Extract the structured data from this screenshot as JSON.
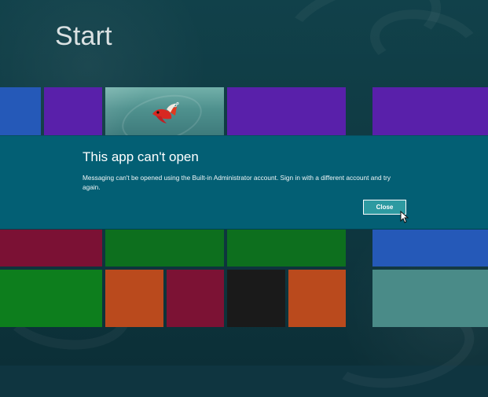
{
  "screen": {
    "title": "Start"
  },
  "dialog": {
    "title": "This app can't open",
    "message": "Messaging can't be opened using the Built-in Administrator account.  Sign in with a different account and try again.",
    "close_label": "Close"
  },
  "icons": {
    "fish": "fish-icon",
    "cursor": "cursor-icon"
  },
  "colors": {
    "background": "#0f3540",
    "dialog_band": "#035f74",
    "button_fill": "#2d9aa1",
    "blue_tile": "#2559b8",
    "purple_tile": "#5920aa",
    "green_tile": "#0d6f1e",
    "red_tile": "#7b1134",
    "orange_tile": "#ba4a1d",
    "black_tile": "#1a1a1a",
    "teal_tile": "#4a8b88"
  }
}
